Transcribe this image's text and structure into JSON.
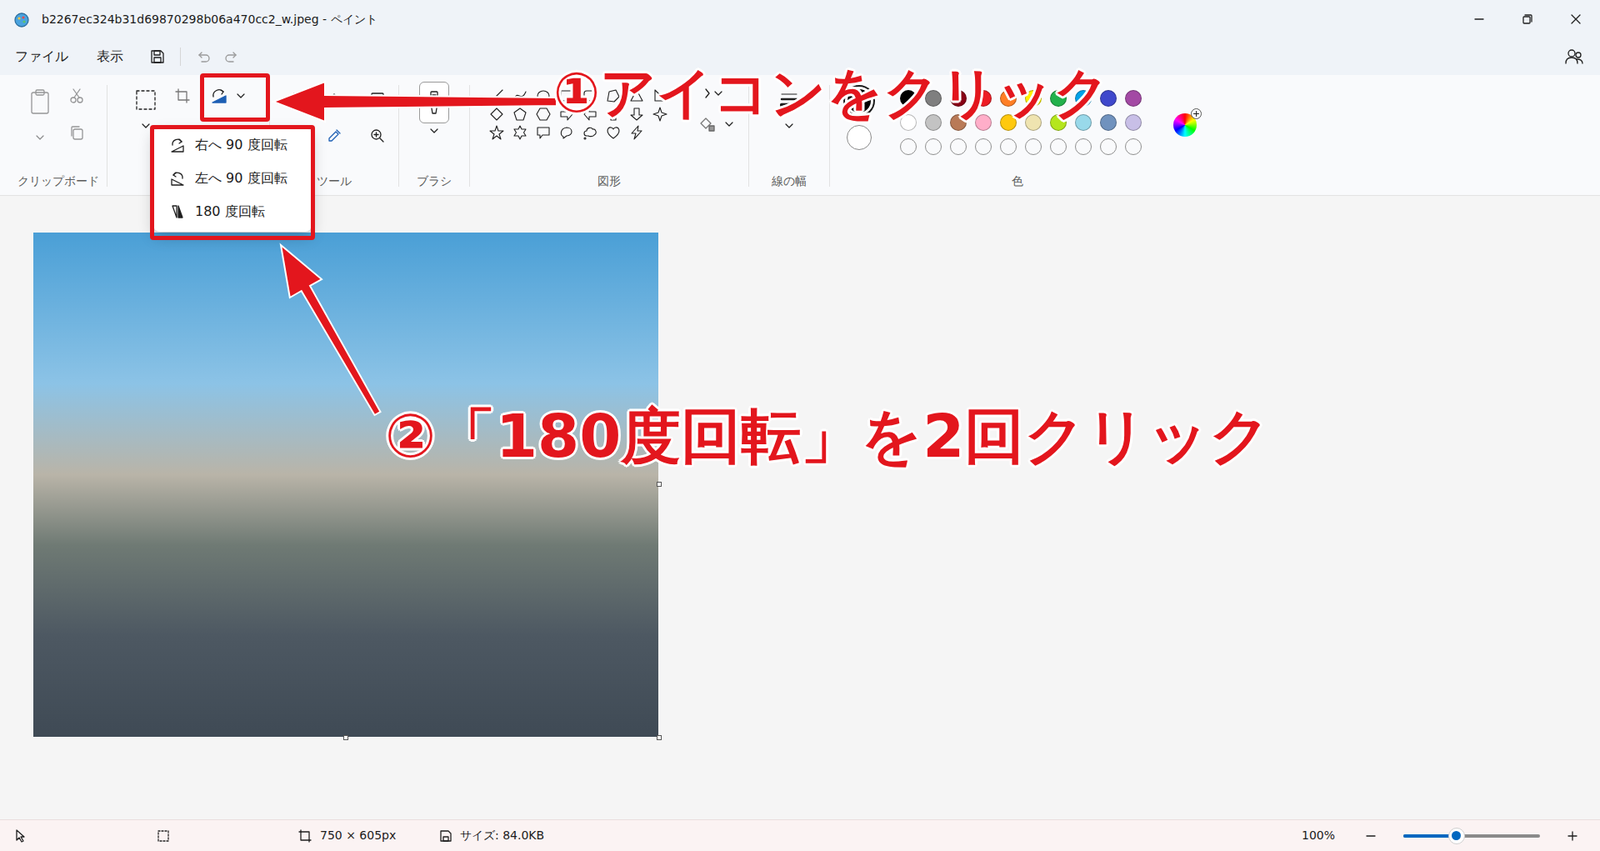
{
  "window": {
    "title": "b2267ec324b31d69870298b06a470cc2_w.jpeg - ペイント"
  },
  "menu": [
    {
      "label": "ファイル"
    },
    {
      "label": "表示"
    }
  ],
  "clipboard": {
    "paste_disabled": true,
    "cut_disabled": true,
    "copy_disabled": true
  },
  "ribbon": {
    "groups": [
      {
        "label": "クリップボード"
      },
      {
        "label": "ツール"
      },
      {
        "label": "ブラシ"
      },
      {
        "label": "図形"
      },
      {
        "label": "線の幅"
      },
      {
        "label": "色"
      }
    ]
  },
  "rotate_menu": {
    "expanded": true,
    "items": [
      {
        "label": "右へ 90 度回転"
      },
      {
        "label": "左へ 90 度回転"
      },
      {
        "label": "180 度回転"
      }
    ]
  },
  "colors": {
    "primary": "#000000",
    "secondary": "#ffffff",
    "palette": [
      {
        "color": "#000000"
      },
      {
        "color": "#7f7f7f"
      },
      {
        "color": "#880015"
      },
      {
        "color": "#ed1c24"
      },
      {
        "color": "#ff7f27"
      },
      {
        "color": "#fff200"
      },
      {
        "color": "#22b14c"
      },
      {
        "color": "#00a2e8"
      },
      {
        "color": "#3f48cc"
      },
      {
        "color": "#a349a4"
      },
      {
        "color": "#ffffff"
      },
      {
        "color": "#c3c3c3"
      },
      {
        "color": "#b97a57"
      },
      {
        "color": "#ffaec9"
      },
      {
        "color": "#ffc90e"
      },
      {
        "color": "#efe4b0"
      },
      {
        "color": "#b5e61d"
      },
      {
        "color": "#99d9ea"
      },
      {
        "color": "#7092be"
      },
      {
        "color": "#c8bfe7"
      }
    ],
    "custom": [
      {
        "filled": false
      },
      {
        "filled": false
      },
      {
        "filled": false
      },
      {
        "filled": false
      },
      {
        "filled": false
      },
      {
        "filled": false
      },
      {
        "filled": false
      },
      {
        "filled": false
      },
      {
        "filled": false
      },
      {
        "filled": false
      }
    ]
  },
  "status_bar": {
    "dimensions": "750 × 605px",
    "file_size": "サイズ: 84.0KB",
    "zoom": "100%",
    "zoom_level": 0.39
  },
  "annotations": [
    {
      "text": "①アイコンをクリック"
    },
    {
      "text": "②「180度回転」を2回クリック"
    }
  ]
}
